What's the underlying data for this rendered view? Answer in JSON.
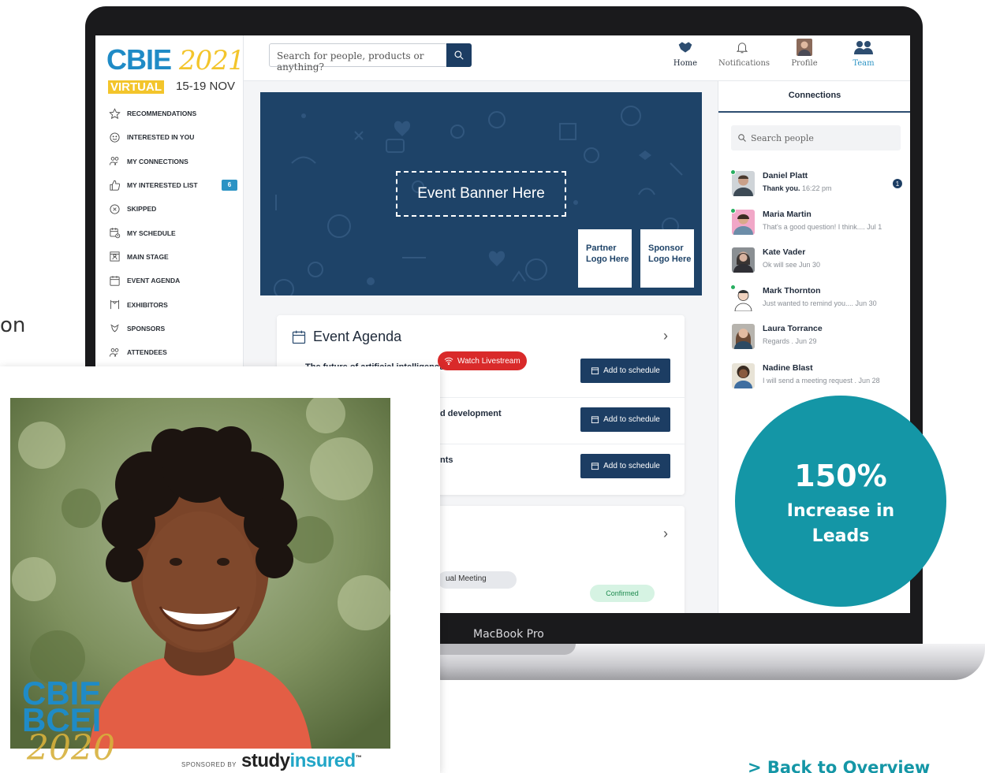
{
  "stray_text": "on",
  "laptop_label": "MacBook Pro",
  "app": {
    "logo": {
      "main": "CBIE",
      "year": "2021",
      "virtual": "VIRTUAL",
      "dates": "15-19 NOV"
    },
    "sidebar": {
      "items": [
        {
          "label": "RECOMMENDATIONS",
          "icon": "star-icon"
        },
        {
          "label": "INTERESTED IN YOU",
          "icon": "smile-icon"
        },
        {
          "label": "MY CONNECTIONS",
          "icon": "people-icon"
        },
        {
          "label": "MY INTERESTED LIST",
          "icon": "thumbs-up-icon",
          "count": "6"
        },
        {
          "label": "SKIPPED",
          "icon": "x-circle-icon"
        },
        {
          "label": "MY SCHEDULE",
          "icon": "calendar-clock-icon"
        },
        {
          "label": "MAIN STAGE",
          "icon": "stage-icon"
        },
        {
          "label": "EVENT AGENDA",
          "icon": "calendar-icon"
        },
        {
          "label": "EXHIBITORS",
          "icon": "booth-icon"
        },
        {
          "label": "SPONSORS",
          "icon": "badge-icon"
        },
        {
          "label": "ATTENDEES",
          "icon": "people-icon"
        }
      ]
    },
    "search": {
      "placeholder": "Search for people, products or anything?"
    },
    "nav": [
      {
        "label": "Home",
        "icon": "handshake-icon"
      },
      {
        "label": "Notifications",
        "icon": "bell-icon"
      },
      {
        "label": "Profile",
        "icon": "profile-icon"
      },
      {
        "label": "Team",
        "icon": "team-icon"
      }
    ],
    "banner": {
      "text": "Event Banner Here",
      "partner": "Partner Logo Here",
      "sponsor": "Sponsor Logo Here"
    },
    "agenda": {
      "title": "Event Agenda",
      "rows": [
        {
          "text": "The future of artificial intelligence",
          "watch": "Watch Livestream",
          "button": "Add to schedule"
        },
        {
          "text": "d development",
          "button": "Add to schedule"
        },
        {
          "text": "nts",
          "button": "Add to schedule"
        }
      ]
    },
    "meetings": {
      "tag": "ual Meeting",
      "status": "Confirmed"
    },
    "connections": {
      "title": "Connections",
      "search_placeholder": "Search people",
      "contacts": [
        {
          "name": "Daniel Platt",
          "msg_bold": "Thank you.",
          "msg": " 16:22 pm",
          "online": true,
          "unread": "1"
        },
        {
          "name": "Maria Martin",
          "msg_bold": "",
          "msg": "That's a good question! I think.... Jul 1",
          "online": true
        },
        {
          "name": "Kate Vader",
          "msg_bold": "",
          "msg": "Ok will see  Jun 30",
          "online": false
        },
        {
          "name": "Mark Thornton",
          "msg_bold": "",
          "msg": "Just wanted to remind you.... Jun 30",
          "online": true
        },
        {
          "name": "Laura Torrance",
          "msg_bold": "",
          "msg": "Regards . Jun 29",
          "online": false
        },
        {
          "name": "Nadine Blast",
          "msg_bold": "",
          "msg": "I will send a meeting request . Jun 28",
          "online": false
        }
      ]
    }
  },
  "photo_card": {
    "logo_line1": "CBIE",
    "logo_line2": "BCEI",
    "logo_year": "2020",
    "sponsored_by": "SPONSORED BY",
    "sponsor_a": "study",
    "sponsor_b": "insured",
    "sponsor_tm": "™"
  },
  "stat": {
    "value": "150%",
    "label": "Increase in Leads"
  },
  "back_link": "> Back to Overview",
  "colors": {
    "brand_blue": "#1f8bc6",
    "navy": "#1c3d63",
    "teal": "#1496a6",
    "live_red": "#d92a2a",
    "gold": "#f3c52b"
  }
}
